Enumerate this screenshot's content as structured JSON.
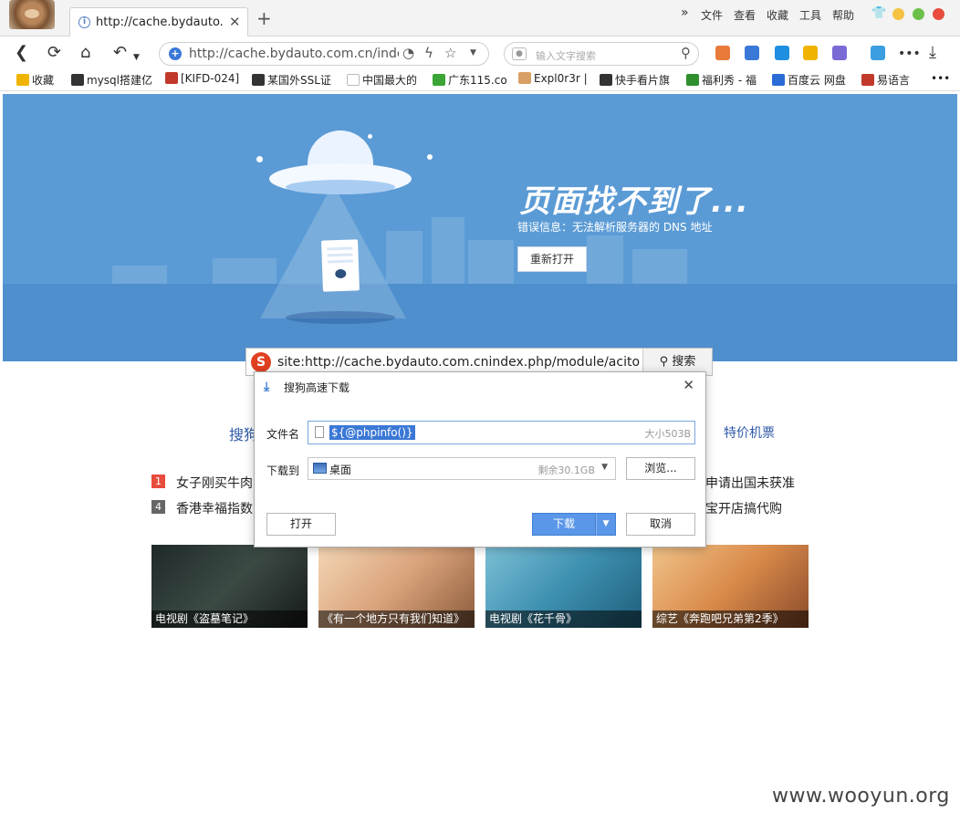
{
  "browser": {
    "tab_title": "http://cache.bydauto.com.cn/index.php",
    "tab_close": "✕",
    "tab_new": "+",
    "menu_overflow": "»",
    "menu": [
      "文件",
      "查看",
      "收藏",
      "工具",
      "帮助"
    ],
    "url": "http://cache.bydauto.com.cn/index.php/module/aciton/",
    "search_placeholder": "输入文字搜索",
    "more": "•••",
    "window_colors": {
      "minimize": "#f5c242",
      "maximize": "#6cc04a",
      "close": "#e84c3d"
    }
  },
  "bookmarks": [
    {
      "label": "收藏",
      "color": "#f0b400"
    },
    {
      "label": "mysql搭建亿",
      "color": "#333333"
    },
    {
      "label": "[KIFD-024]",
      "color": "#c0392b"
    },
    {
      "label": "某国外SSL证",
      "color": "#333333"
    },
    {
      "label": "中国最大的",
      "color": "#bbbbbb"
    },
    {
      "label": "广东115.co",
      "color": "#3aa535"
    },
    {
      "label": "Expl0r3r |",
      "color": "#d9a066"
    },
    {
      "label": "快手看片旗",
      "color": "#333333"
    },
    {
      "label": "福利秀 - 福",
      "color": "#2f8f2f"
    },
    {
      "label": "百度云 网盘",
      "color": "#2b6bd6"
    },
    {
      "label": "易语言",
      "color": "#c0392b"
    }
  ],
  "bookmarks_more": "•••",
  "error_page": {
    "title": "页面找不到了...",
    "message": "错误信息：无法解析服务器的 DNS 地址",
    "reopen_button": "重新打开"
  },
  "page_search": {
    "logo": "S",
    "query": "site:http://cache.bydauto.com.cnindex.php/module/aciton/",
    "button": "搜索"
  },
  "nav_links": [
    "搜狗",
    "特价机票"
  ],
  "news": [
    {
      "rank": "1",
      "text": "女子刚买牛肉",
      "color": "#e84c3d"
    },
    {
      "rank": "4",
      "text": "香港幸福指数",
      "color": "#666666"
    },
    {
      "text": "申请出国未获准"
    },
    {
      "text": "宝开店搞代购"
    }
  ],
  "thumbnails": [
    {
      "caption": "电视剧《盗墓笔记》",
      "bg": "linear-gradient(135deg,#1e2a2a,#3c4a44 50%,#151a18)"
    },
    {
      "caption": "《有一个地方只有我们知道》",
      "bg": "linear-gradient(135deg,#f4d7b6,#d9a27a 50%,#8a5a3a)"
    },
    {
      "caption": "电视剧《花千骨》",
      "bg": "linear-gradient(135deg,#7cc0d6,#3d8fb0 50%,#1e5f7a)"
    },
    {
      "caption": "综艺《奔跑吧兄弟第2季》",
      "bg": "linear-gradient(135deg,#f0c48a,#d98a4a 50%,#8a4a2a)"
    }
  ],
  "dialog": {
    "title": "搜狗高速下载",
    "close": "✕",
    "filename_label": "文件名",
    "filename": "${@phpinfo()}",
    "size": "大小503B",
    "saveto_label": "下载到",
    "saveto": "桌面",
    "free_space": "剩余30.1GB",
    "browse": "浏览...",
    "open": "打开",
    "download": "下载",
    "cancel": "取消"
  },
  "watermark": "www.wooyun.org"
}
